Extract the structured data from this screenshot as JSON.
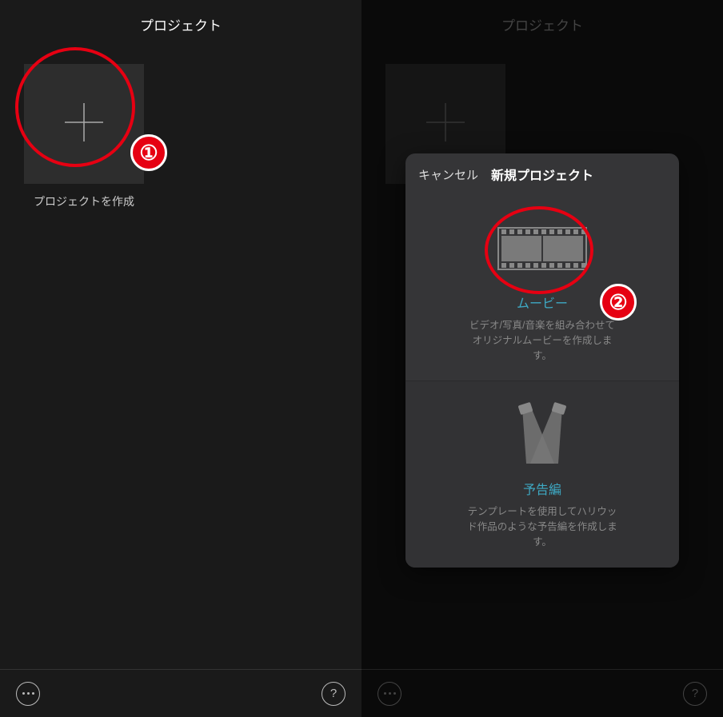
{
  "left": {
    "title": "プロジェクト",
    "create_label": "プロジェクトを作成",
    "more_name": "more",
    "help_name": "help",
    "help_glyph": "?"
  },
  "right": {
    "title": "プロジェクト",
    "more_name": "more",
    "help_name": "help",
    "help_glyph": "?"
  },
  "modal": {
    "cancel": "キャンセル",
    "title": "新規プロジェクト",
    "movie": {
      "title": "ムービー",
      "desc": "ビデオ/写真/音楽を組み合わせて\nオリジナルムービーを作成しま\nす。"
    },
    "trailer": {
      "title": "予告編",
      "desc": "テンプレートを使用してハリウッ\nド作品のような予告編を作成しま\nす。"
    }
  },
  "annotations": {
    "badge1": "①",
    "badge2": "②"
  }
}
